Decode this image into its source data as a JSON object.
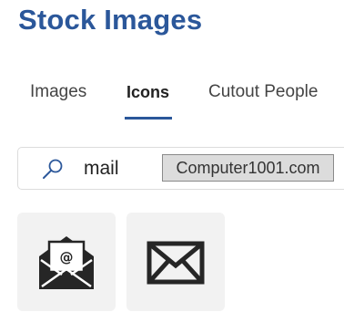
{
  "header": {
    "title": "Stock Images"
  },
  "tabs": [
    {
      "label": "Images",
      "selected": false
    },
    {
      "label": "Icons",
      "selected": true
    },
    {
      "label": "Cutout People",
      "selected": false
    }
  ],
  "search": {
    "value": "mail",
    "icon": "search-icon"
  },
  "watermark": {
    "text": "Computer1001.com"
  },
  "results": [
    {
      "icon": "open-envelope-at-sign-icon"
    },
    {
      "icon": "envelope-icon"
    }
  ],
  "colors": {
    "accent": "#2b579a",
    "tile_background": "#f2f2f2",
    "icon_fill": "#262626"
  }
}
